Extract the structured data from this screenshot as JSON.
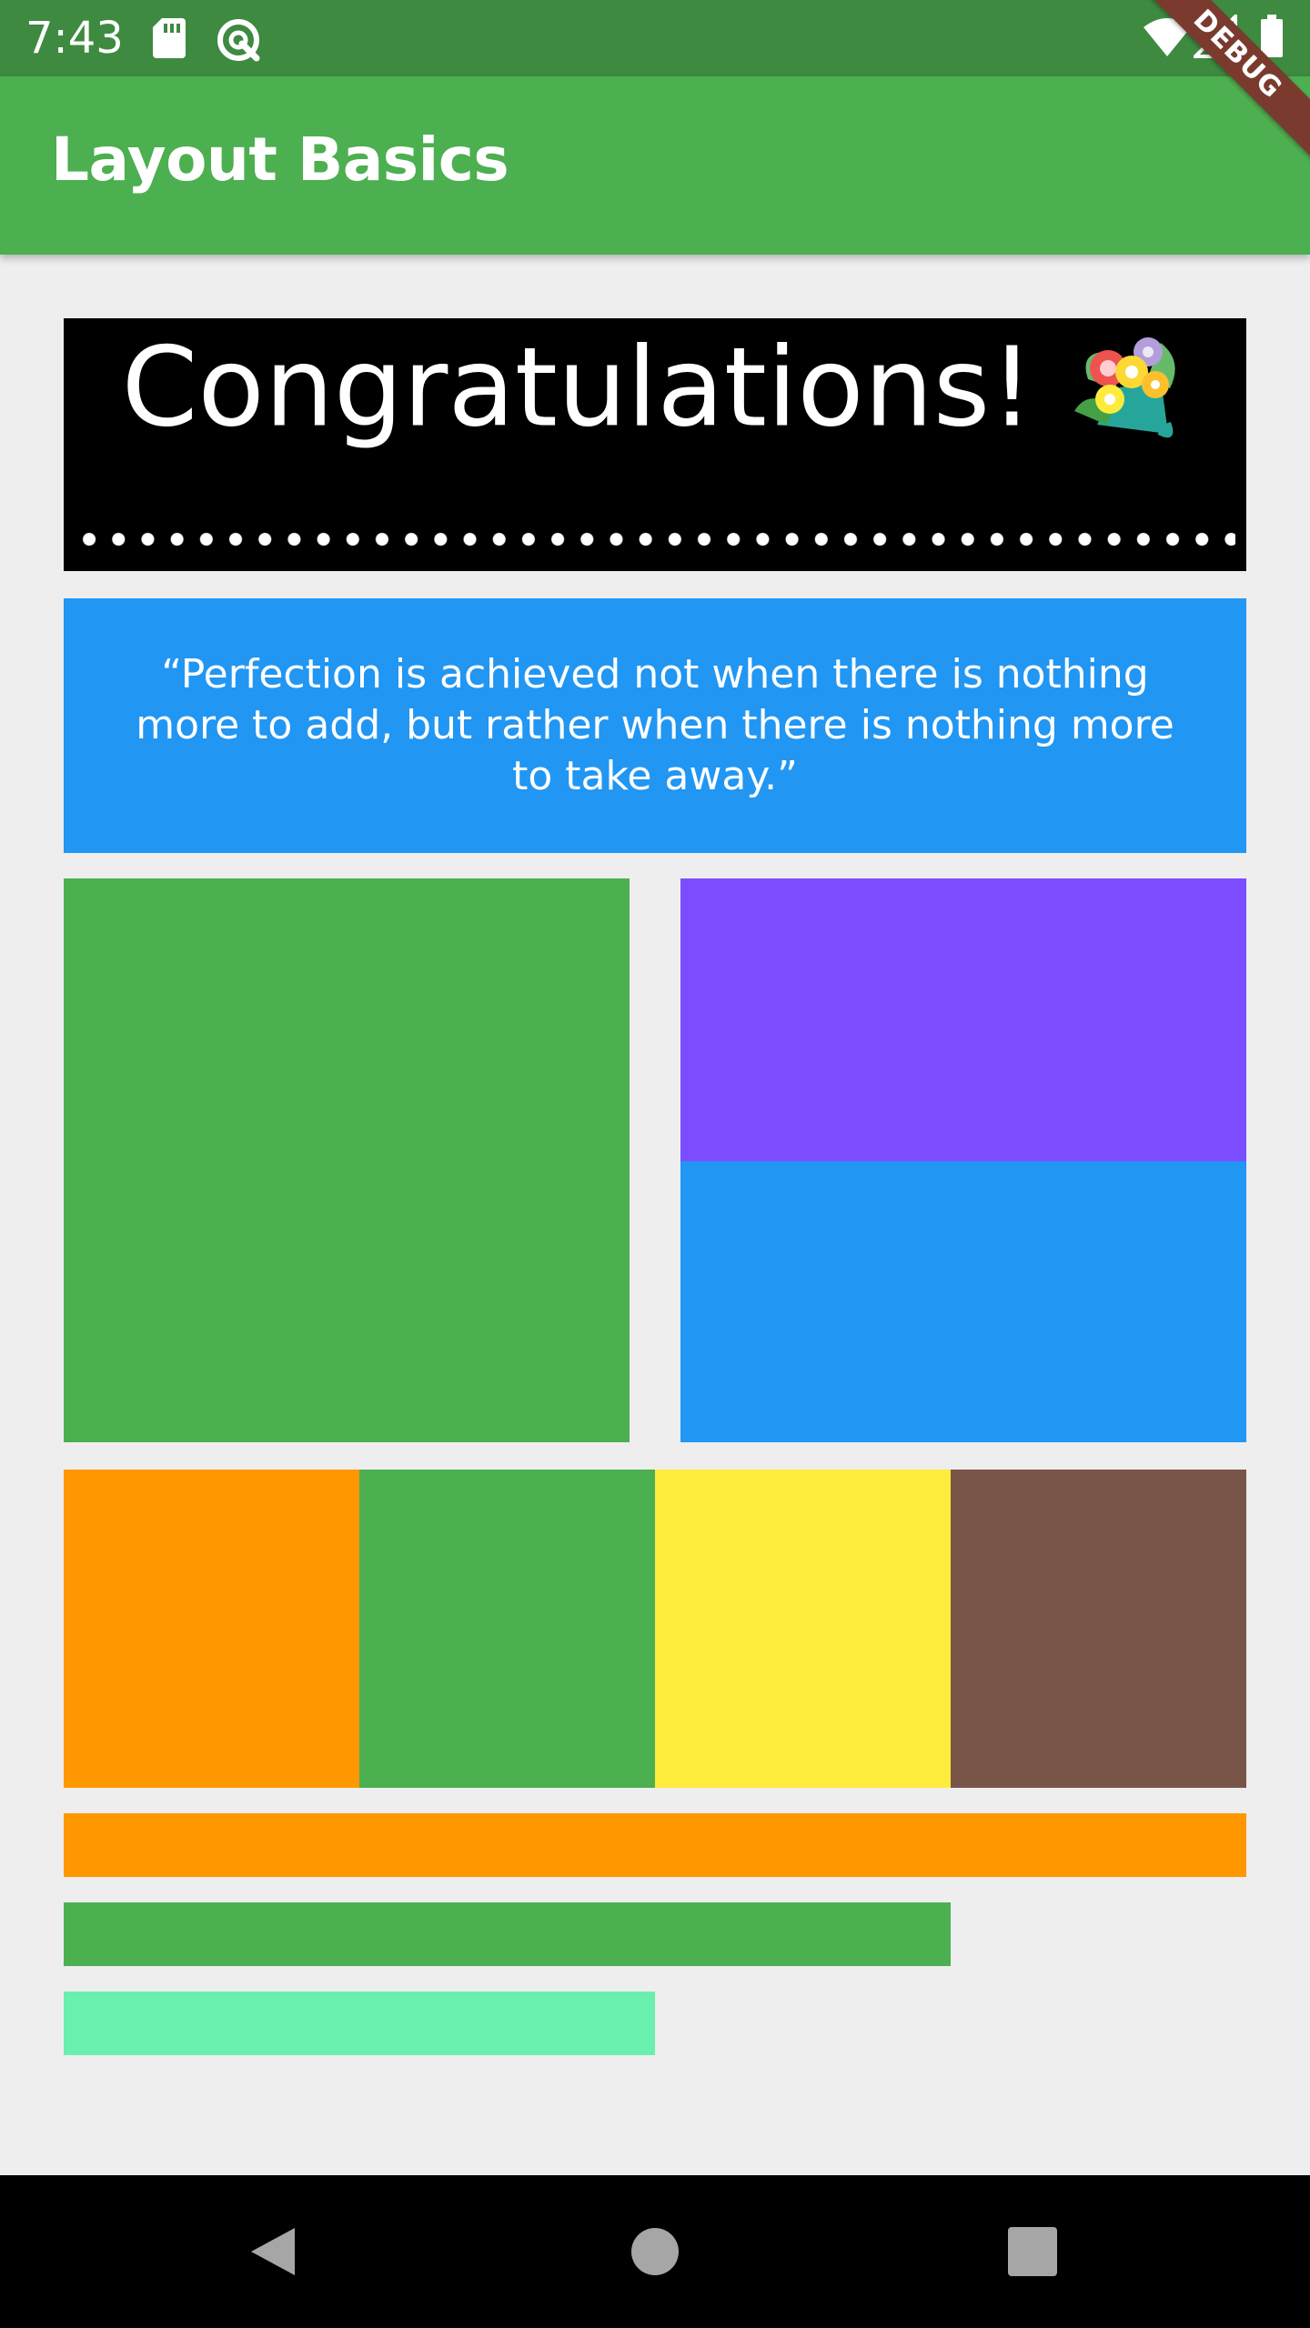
{
  "status_bar": {
    "time": "7:43",
    "icons": [
      "sd-card-icon",
      "q-logo-icon",
      "wifi-icon",
      "signal-icon",
      "battery-icon"
    ],
    "background_color": "#3e8a40"
  },
  "debug_banner": {
    "label": "DEBUG"
  },
  "app_bar": {
    "title": "Layout Basics",
    "color": "#4caf50"
  },
  "congrats": {
    "title": "Congratulations!",
    "emoji_icon": "bouquet-icon",
    "decoration": "dotted-line"
  },
  "quote": {
    "text": "“Perfection is achieved not when there is nothing more to add, but rather when there is nothing more to take away.”",
    "color": "#2196f3"
  },
  "blocks": {
    "green": "#4caf50",
    "purple": "#7c4dff",
    "blue": "#2196f3",
    "orange": "#ff9800",
    "yellow": "#ffeb3b",
    "brown": "#795548",
    "mint": "#69f0ae"
  },
  "nav_bar": {
    "buttons": [
      "back-icon",
      "home-icon",
      "recents-icon"
    ]
  }
}
